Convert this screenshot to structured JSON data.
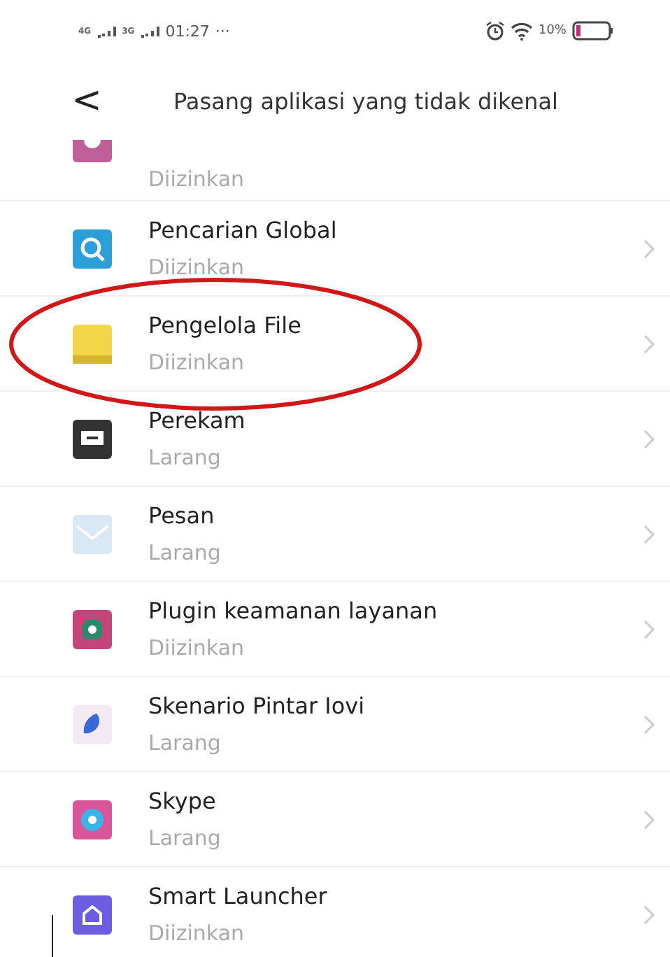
{
  "status_bar": {
    "network_1": "4G",
    "network_2": "3G",
    "time": "01:27",
    "more": "···",
    "battery": "10%"
  },
  "header": {
    "back": "<",
    "title": "Pasang aplikasi yang tidak dikenal"
  },
  "apps": [
    {
      "status": "Diizinkan",
      "highlighted": false
    },
    {
      "name": "Pencarian Global",
      "status": "Diizinkan",
      "highlighted": false
    },
    {
      "name": "Pengelola File",
      "status": "Diizinkan",
      "highlighted": true
    },
    {
      "name": "Perekam",
      "status": "Larang",
      "highlighted": false
    },
    {
      "name": "Pesan",
      "status": "Larang",
      "highlighted": false
    },
    {
      "name": "Plugin keamanan layanan",
      "status": "Diizinkan",
      "highlighted": false
    },
    {
      "name": "Skenario Pintar Iovi",
      "status": "Larang",
      "highlighted": false
    },
    {
      "name": "Skype",
      "status": "Larang",
      "highlighted": false
    },
    {
      "name": "Smart Launcher",
      "status": "Diizinkan",
      "highlighted": false
    }
  ]
}
